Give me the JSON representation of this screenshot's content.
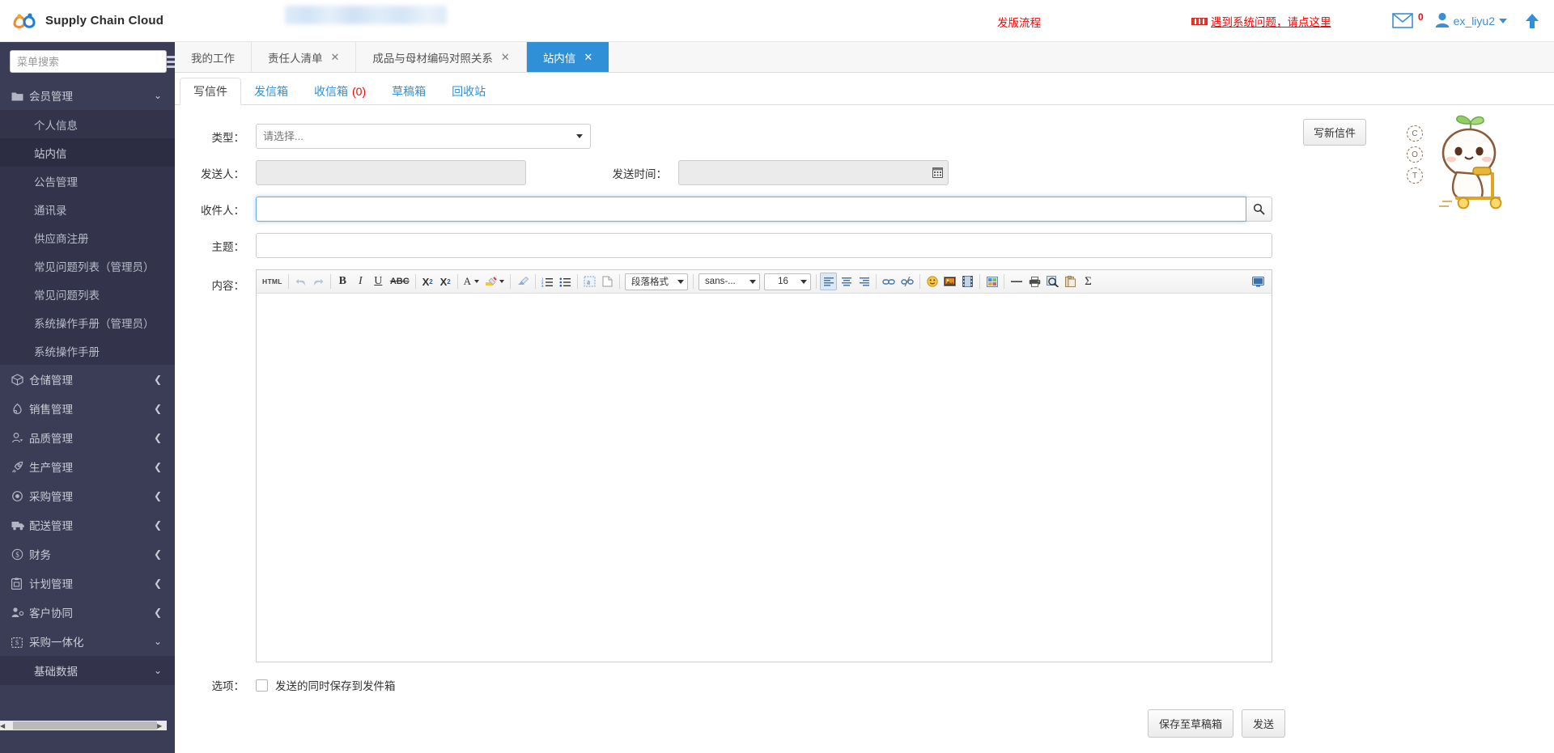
{
  "app": {
    "brand": "Supply Chain Cloud",
    "logo_icon": "swirl-logo-icon"
  },
  "topbar": {
    "release_link": "发版流程",
    "problem_link": "遇到系统问题，请点这里",
    "mail_icon": "envelope-icon",
    "mail_count": "0",
    "user_name": "ex_liyu2",
    "user_icon": "user-avatar-icon",
    "caret_icon": "chevron-down-icon",
    "scroll_top_icon": "arrow-up-icon"
  },
  "sidebar": {
    "search_placeholder": "菜单搜索",
    "search_value": "",
    "hamburger_icon": "hamburger-menu-icon",
    "groups": [
      {
        "label": "会员管理",
        "icon": "folder-icon",
        "chevron": "chevron-down-icon",
        "expanded": true,
        "items": [
          {
            "label": "个人信息",
            "active": false
          },
          {
            "label": "站内信",
            "active": true
          },
          {
            "label": "公告管理",
            "active": false
          },
          {
            "label": "通讯录",
            "active": false
          },
          {
            "label": "供应商注册",
            "active": false
          },
          {
            "label": "常见问题列表（管理员）",
            "active": false
          },
          {
            "label": "常见问题列表",
            "active": false
          },
          {
            "label": "系统操作手册（管理员）",
            "active": false
          },
          {
            "label": "系统操作手册",
            "active": false
          }
        ]
      },
      {
        "label": "仓储管理",
        "icon": "box-icon",
        "chevron": "chevron-left-icon",
        "expanded": false,
        "items": []
      },
      {
        "label": "销售管理",
        "icon": "sales-icon",
        "chevron": "chevron-left-icon",
        "expanded": false,
        "items": []
      },
      {
        "label": "品质管理",
        "icon": "quality-person-icon",
        "chevron": "chevron-left-icon",
        "expanded": false,
        "items": []
      },
      {
        "label": "生产管理",
        "icon": "rocket-icon",
        "chevron": "chevron-left-icon",
        "expanded": false,
        "items": []
      },
      {
        "label": "采购管理",
        "icon": "target-icon",
        "chevron": "chevron-left-icon",
        "expanded": false,
        "items": []
      },
      {
        "label": "配送管理",
        "icon": "truck-icon",
        "chevron": "chevron-left-icon",
        "expanded": false,
        "items": []
      },
      {
        "label": "财务",
        "icon": "dollar-circle-icon",
        "chevron": "chevron-left-icon",
        "expanded": false,
        "items": []
      },
      {
        "label": "计划管理",
        "icon": "clipboard-icon",
        "chevron": "chevron-left-icon",
        "expanded": false,
        "items": []
      },
      {
        "label": "客户协同",
        "icon": "people-icon",
        "chevron": "chevron-left-icon",
        "expanded": false,
        "items": []
      },
      {
        "label": "采购一体化",
        "icon": "purchase-bag-icon",
        "chevron": "chevron-down-icon",
        "expanded": true,
        "items": []
      }
    ],
    "sub_plain": "基础数据",
    "sub_plain_chevron": "chevron-down-icon"
  },
  "tabs": [
    {
      "label": "我的工作",
      "closable": false,
      "active": false
    },
    {
      "label": "责任人清单",
      "closable": true,
      "active": false
    },
    {
      "label": "成品与母材编码对照关系",
      "closable": true,
      "active": false
    },
    {
      "label": "站内信",
      "closable": true,
      "active": true
    }
  ],
  "tab_close_icon": "close-icon",
  "subtabs": [
    {
      "label": "写信件",
      "active": true,
      "badge": ""
    },
    {
      "label": "发信箱",
      "active": false,
      "badge": ""
    },
    {
      "label": "收信箱",
      "active": false,
      "badge": "(0)"
    },
    {
      "label": "草稿箱",
      "active": false,
      "badge": ""
    },
    {
      "label": "回收站",
      "active": false,
      "badge": ""
    }
  ],
  "form": {
    "type_label": "类型：",
    "type_value": "请选择...",
    "type_options": [
      "请选择..."
    ],
    "sender_label": "发送人：",
    "sender_value": "",
    "send_time_label": "发送时间：",
    "send_time_value": "",
    "date_icon": "calendar-icon",
    "recipient_label": "收件人：",
    "recipient_value": "",
    "recipient_search_icon": "search-icon",
    "subject_label": "主题：",
    "subject_value": "",
    "content_label": "内容：",
    "content_value": "",
    "options_label": "选项：",
    "option_save_to_sent": "发送的同时保存到发件箱",
    "option_checked": false,
    "write_new_button": "写新信件",
    "save_draft_button": "保存至草稿箱",
    "send_button": "发送"
  },
  "editor": {
    "paragraph_format": "段落格式",
    "font_family": "sans-...",
    "font_size": "16",
    "tools": [
      "html-source-icon",
      "undo-icon",
      "redo-icon",
      "bold-icon",
      "italic-icon",
      "underline-icon",
      "strikethrough-icon",
      "superscript-icon",
      "subscript-icon",
      "text-color-icon",
      "highlight-color-icon",
      "remove-format-icon",
      "ordered-list-icon",
      "unordered-list-icon",
      "anchor-icon",
      "page-break-icon",
      "align-left-icon",
      "align-center-icon",
      "align-right-icon",
      "link-icon",
      "unlink-icon",
      "emoji-icon",
      "image-icon",
      "video-icon",
      "gallery-icon",
      "horizontal-rule-icon",
      "print-icon",
      "preview-icon",
      "paste-icon",
      "sigma-icon",
      "fullscreen-icon"
    ]
  },
  "mascot": {
    "name": "cute-mascot-scooter",
    "badges": [
      "C",
      "O",
      "T"
    ]
  },
  "colors": {
    "sidebar_bg": "#3b3c55",
    "sidebar_sub_bg": "#33344b",
    "active_tab": "#2f90d8",
    "link_blue": "#2f90d8",
    "alert_red": "#ff0000"
  }
}
